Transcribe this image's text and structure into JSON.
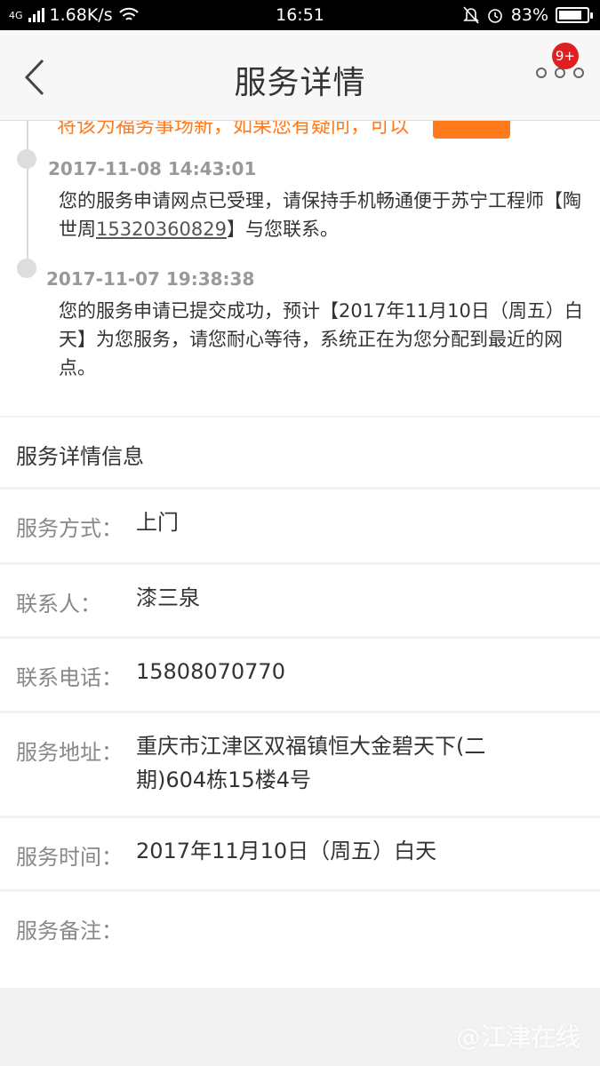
{
  "status_bar": {
    "network_type": "4G",
    "speed": "1.68K/s",
    "time": "16:51",
    "battery": "83%",
    "battery_level": 0.83
  },
  "header": {
    "title": "服务详情",
    "badge": "9+"
  },
  "timeline": {
    "top_text": "将该为福务事场新，如果您有疑问，可以",
    "entries": [
      {
        "time": "2017-11-08 14:43:01",
        "text_before": "您的服务申请网点已受理，请保持手机畅通便于苏宁工程师【陶世周",
        "phone": "15320360829",
        "text_after": "】与您联系。"
      },
      {
        "time": "2017-11-07 19:38:38",
        "text": "您的服务申请已提交成功，预计【2017年11月10日（周五）白天】为您服务，请您耐心等待，系统正在为您分配到最近的网点。"
      }
    ]
  },
  "details": {
    "section_title": "服务详情信息",
    "rows": [
      {
        "label": "服务方式：",
        "value": "上门"
      },
      {
        "label": "联系人：",
        "value": "漆三泉"
      },
      {
        "label": "联系电话：",
        "value": "15808070770"
      },
      {
        "label": "服务地址：",
        "value": "重庆市江津区双福镇恒大金碧天下(二期)604栋15楼4号"
      },
      {
        "label": "服务时间：",
        "value": "2017年11月10日（周五）白天"
      },
      {
        "label": "服务备注：",
        "value": ""
      }
    ]
  },
  "watermark": "@江津在线",
  "colors": {
    "accent_orange": "#ff7a1a",
    "badge_red": "#e02020"
  }
}
